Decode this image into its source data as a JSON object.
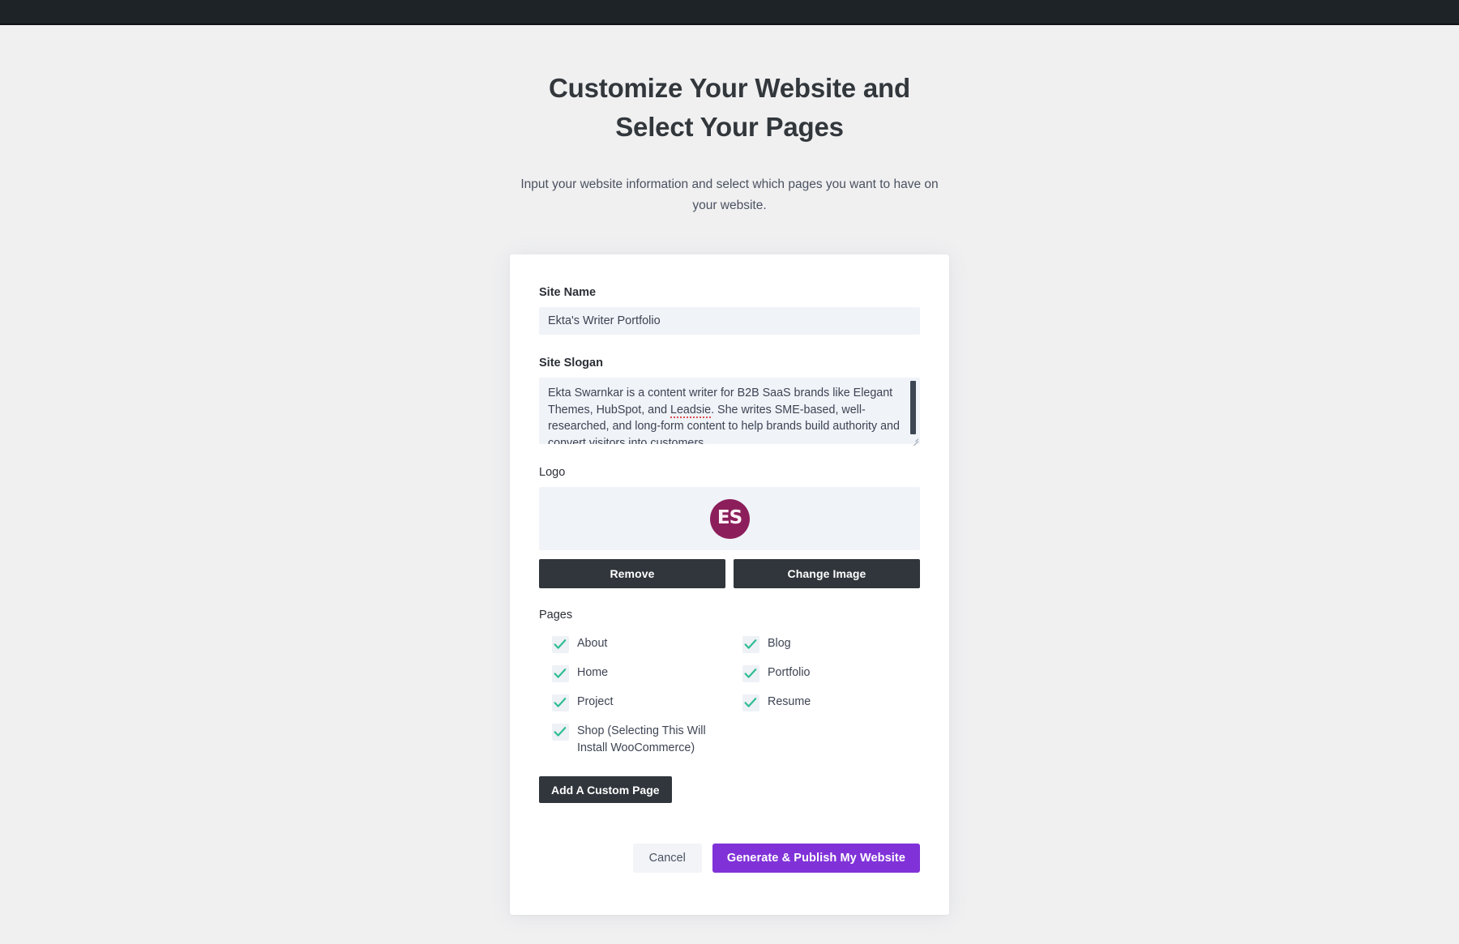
{
  "admin_bar": {
    "present": true,
    "background": "#1d2327"
  },
  "hero": {
    "title": "Customize Your Website and Select Your Pages",
    "subtitle": "Input your website information and select which pages you want to have on your website."
  },
  "form": {
    "site_name": {
      "label": "Site Name",
      "value": "Ekta's Writer Portfolio",
      "placeholder": "Site Name"
    },
    "site_slogan": {
      "label": "Site Slogan",
      "value_part1": "Ekta Swarnkar is a content writer for B2B SaaS brands like Elegant Themes, HubSpot, and ",
      "misspelled_word": "Leadsie",
      "value_part2": ". She writes SME-based, well-researched, and long-form content to help brands build authority and convert visitors into customers.",
      "placeholder": "Site Slogan"
    },
    "logo": {
      "label": "Logo",
      "initials": "ES",
      "color": "#8c1f5b",
      "remove_label": "Remove",
      "change_label": "Change Image"
    },
    "pages": {
      "label": "Pages",
      "items": [
        {
          "label": "About",
          "checked": true
        },
        {
          "label": "Blog",
          "checked": true
        },
        {
          "label": "Home",
          "checked": true
        },
        {
          "label": "Portfolio",
          "checked": true
        },
        {
          "label": "Project",
          "checked": true
        },
        {
          "label": "Resume",
          "checked": true
        },
        {
          "label": "Shop (Selecting This Will Install WooCommerce)",
          "checked": true
        }
      ],
      "add_custom_label": "Add A Custom Page"
    }
  },
  "footer": {
    "cancel_label": "Cancel",
    "primary_label": "Generate & Publish My Website",
    "primary_color": "#8032d8"
  },
  "colors": {
    "page_background": "#f0f0f1",
    "card_background": "#ffffff",
    "input_background": "#f0f3f8",
    "dark_button": "#31363c",
    "check_green": "#2fbd95"
  }
}
